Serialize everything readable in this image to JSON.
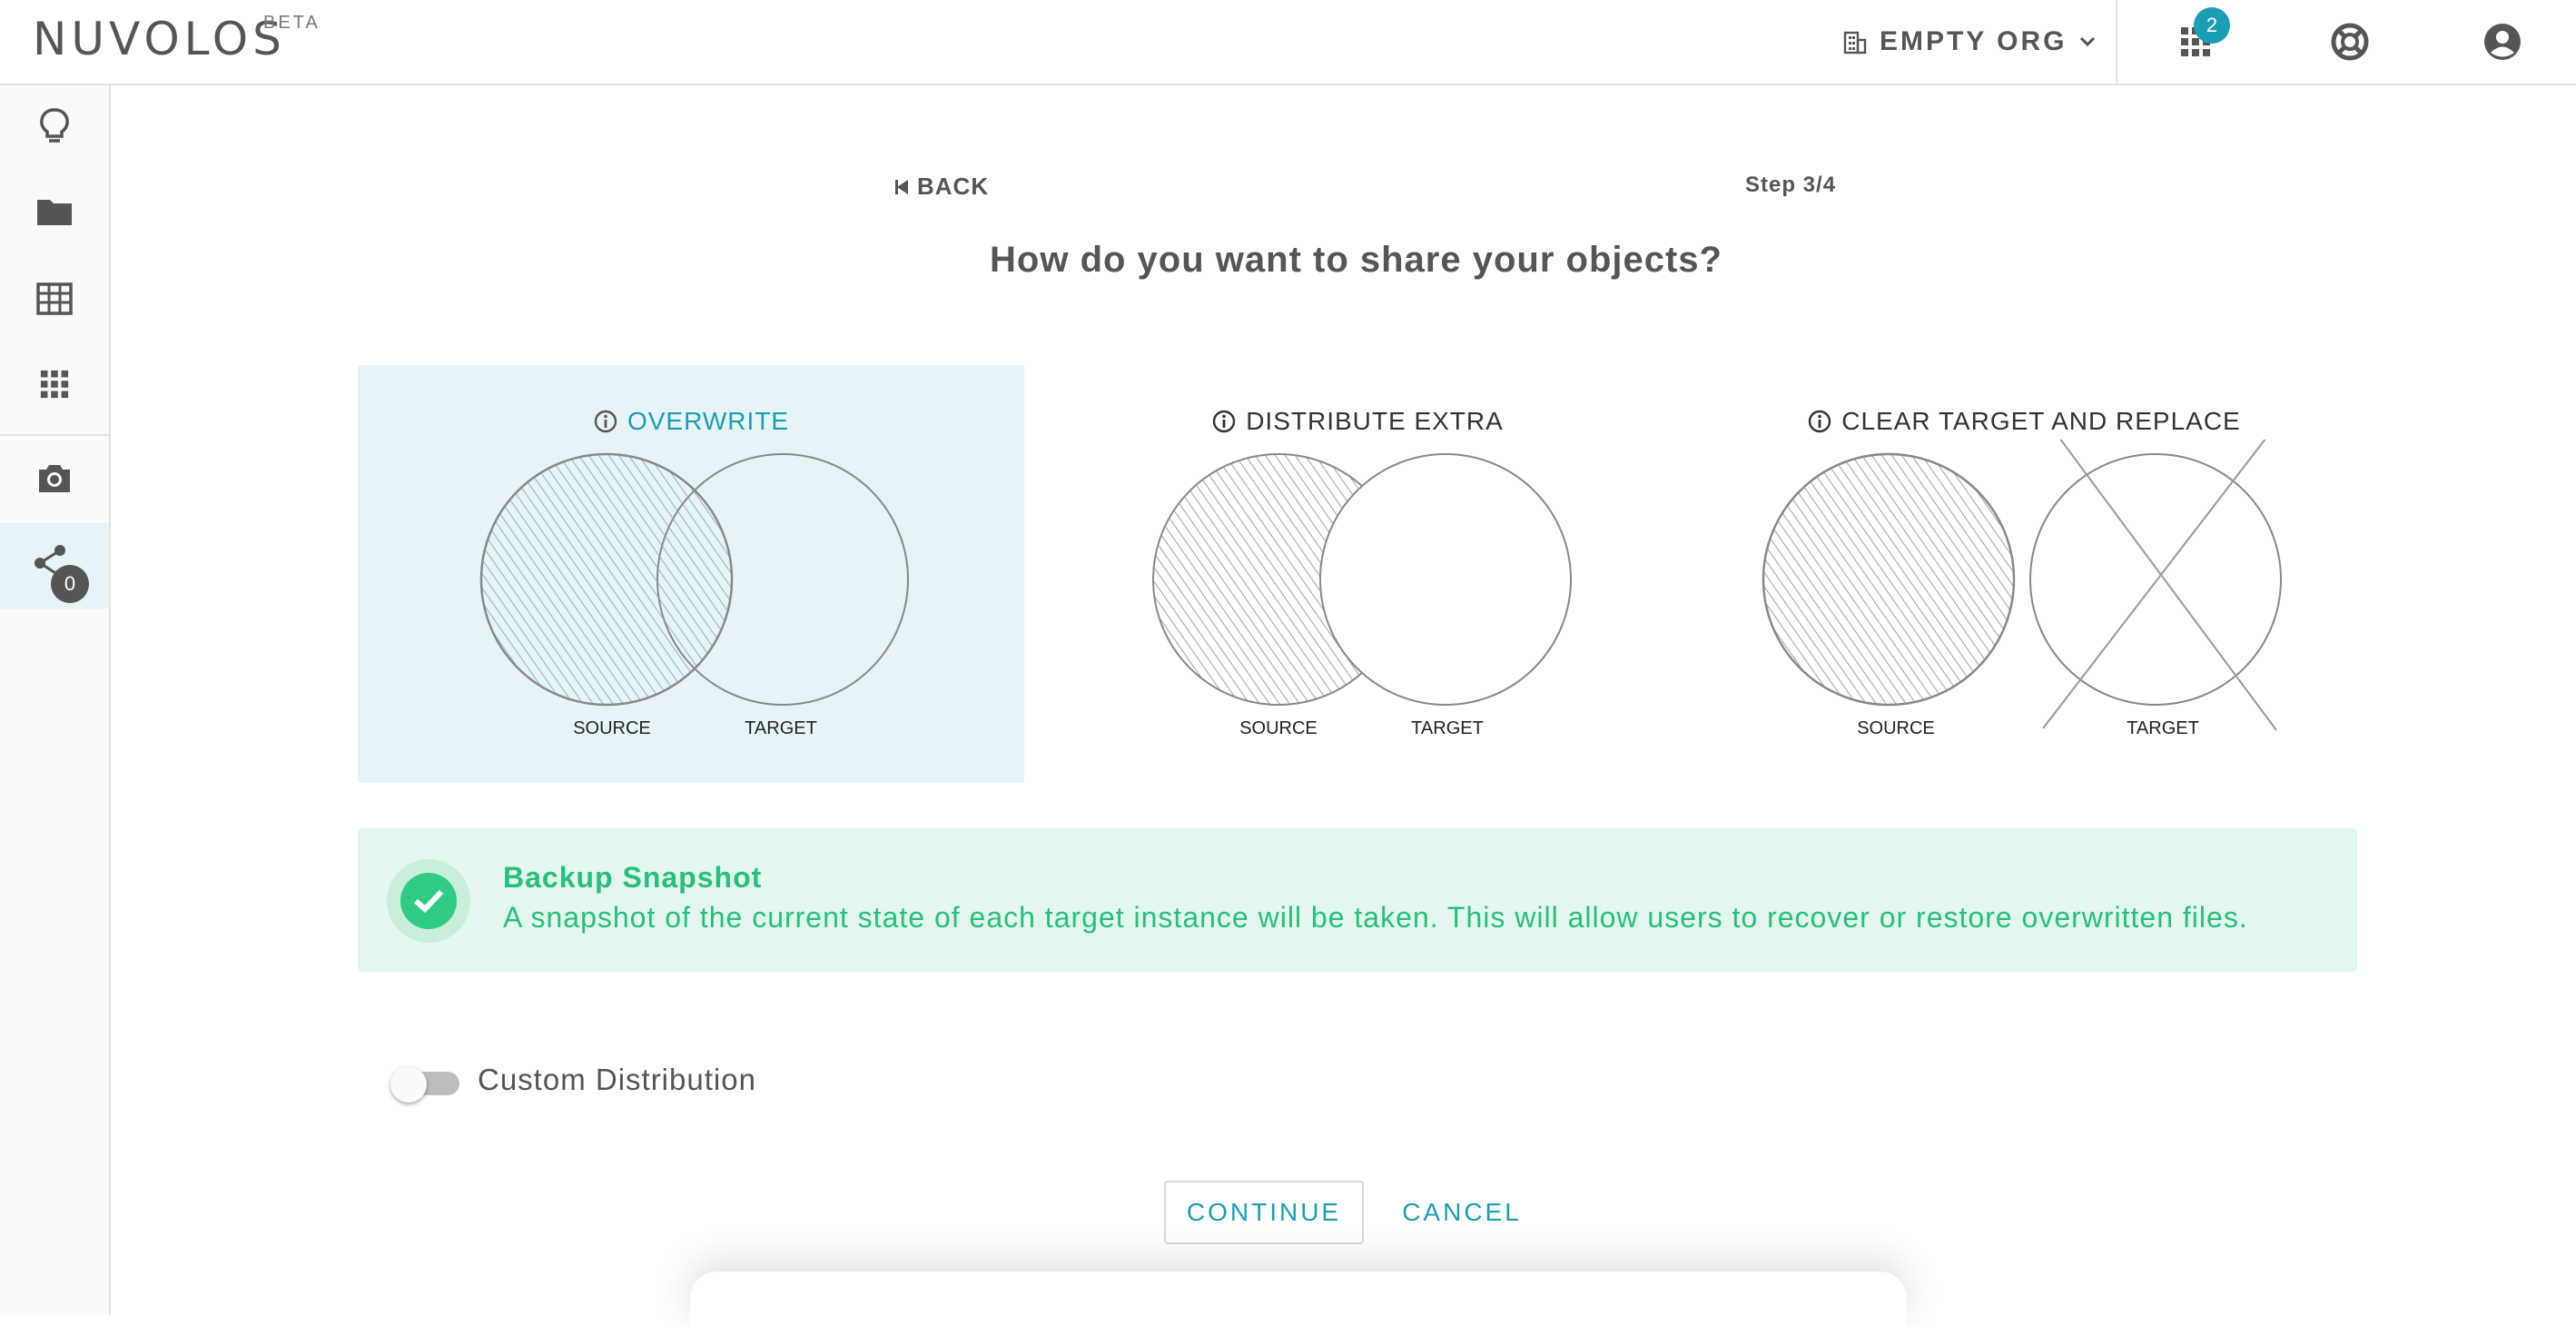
{
  "app": {
    "brand": "NUVOLOS",
    "beta": "BETA"
  },
  "header": {
    "org_name": "EMPTY ORG",
    "apps_badge": "2"
  },
  "sidebar": {
    "share_count": "0"
  },
  "nav": {
    "back_label": "BACK",
    "step_label": "Step 3/4"
  },
  "question": "How do you want to share your objects?",
  "options": [
    {
      "title": "OVERWRITE",
      "source_label": "SOURCE",
      "target_label": "TARGET",
      "selected": true
    },
    {
      "title": "DISTRIBUTE EXTRA",
      "source_label": "SOURCE",
      "target_label": "TARGET",
      "selected": false
    },
    {
      "title": "CLEAR TARGET AND REPLACE",
      "source_label": "SOURCE",
      "target_label": "TARGET",
      "selected": false
    }
  ],
  "snapshot": {
    "title": "Backup Snapshot",
    "description": "A snapshot of the current state of each target instance will be taken. This will allow users to recover or restore overwritten files."
  },
  "custom_distribution": {
    "label": "Custom Distribution",
    "enabled": false
  },
  "actions": {
    "continue_label": "CONTINUE",
    "cancel_label": "CANCEL"
  },
  "colors": {
    "accent": "#1a9eb5",
    "success": "#27c07b",
    "selected_bg": "#e6f4f7",
    "snapshot_bg": "#e3f7ee"
  },
  "icons": [
    "building-icon",
    "chevron-down-icon",
    "apps-grid-icon",
    "help-lifebuoy-icon",
    "account-icon",
    "lightbulb-icon",
    "folder-icon",
    "table-icon",
    "apps-icon",
    "camera-icon",
    "share-icon",
    "info-icon",
    "check-icon",
    "back-arrow-icon"
  ]
}
